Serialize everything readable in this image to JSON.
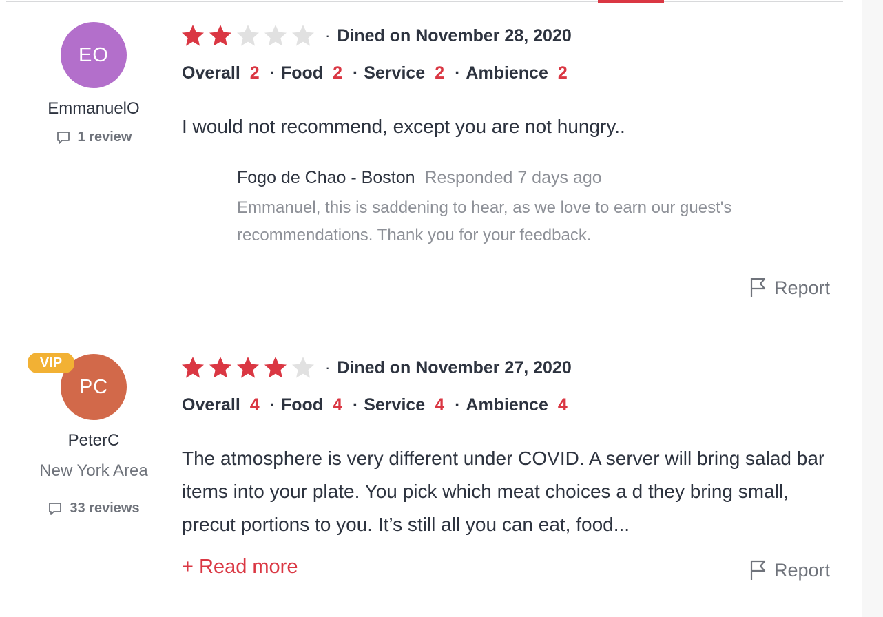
{
  "colors": {
    "accent": "#da3743",
    "star_on": "#da3743",
    "star_off": "#e1e1e1",
    "vip": "#f2b134"
  },
  "reviews": [
    {
      "avatar_initials": "EO",
      "avatar_color": "#b36fcb",
      "vip": false,
      "username": "EmmanuelO",
      "location": "",
      "review_count": "1 review",
      "stars": 2,
      "dined": "Dined on November 28, 2020",
      "ratings": {
        "overall_label": "Overall",
        "overall": "2",
        "food_label": "Food",
        "food": "2",
        "service_label": "Service",
        "service": "2",
        "ambience_label": "Ambience",
        "ambience": "2"
      },
      "text": "I would not recommend, except you are not hungry..",
      "response": {
        "name": "Fogo de Chao - Boston",
        "time": "Responded 7 days ago",
        "text": "Emmanuel, this is saddening to hear, as we love to earn our guest's recommendations. Thank you for your feedback."
      },
      "report_label": "Report"
    },
    {
      "avatar_initials": "PC",
      "avatar_color": "#d2694a",
      "vip": true,
      "vip_label": "VIP",
      "username": "PeterC",
      "location": "New York Area",
      "review_count": "33 reviews",
      "stars": 4,
      "dined": "Dined on November 27, 2020",
      "ratings": {
        "overall_label": "Overall",
        "overall": "4",
        "food_label": "Food",
        "food": "4",
        "service_label": "Service",
        "service": "4",
        "ambience_label": "Ambience",
        "ambience": "4"
      },
      "text": "The atmosphere is very different under COVID. A server will bring salad bar items into your plate. You pick which meat choices a d they bring small, precut portions to you. It’s still all you can eat, food...",
      "read_more": "+ Read more",
      "report_label": "Report"
    }
  ],
  "separator": "·"
}
